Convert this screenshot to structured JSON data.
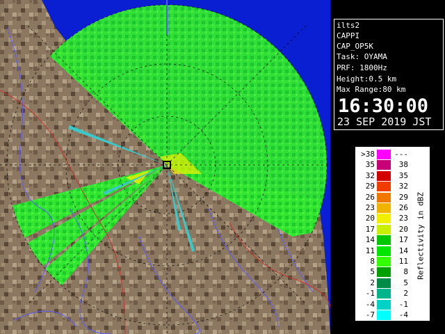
{
  "info": {
    "lines": [
      "ilts2",
      "CAPPI",
      "CAP_OP5K",
      "Task: OYAMA",
      "PRF: 1800Hz",
      "Height:0.5 km",
      "Max Range:80 km"
    ],
    "time": "16:30:00",
    "date": "23 SEP 2019 JST"
  },
  "legend": {
    "axis_label": "Reflectivity in dBZ",
    "rows": [
      {
        "lo": ">38",
        "hi": "---",
        "color": "#ff00ff"
      },
      {
        "lo": "35",
        "hi": "38",
        "color": "#c80078"
      },
      {
        "lo": "32",
        "hi": "35",
        "color": "#d20000"
      },
      {
        "lo": "29",
        "hi": "32",
        "color": "#f03c00"
      },
      {
        "lo": "26",
        "hi": "29",
        "color": "#f07800"
      },
      {
        "lo": "23",
        "hi": "26",
        "color": "#f0b400"
      },
      {
        "lo": "20",
        "hi": "23",
        "color": "#f0f000"
      },
      {
        "lo": "17",
        "hi": "20",
        "color": "#c8f000"
      },
      {
        "lo": "14",
        "hi": "17",
        "color": "#00c800"
      },
      {
        "lo": "11",
        "hi": "14",
        "color": "#00e600"
      },
      {
        "lo": "8",
        "hi": "11",
        "color": "#32ff00"
      },
      {
        "lo": "5",
        "hi": "8",
        "color": "#00a000"
      },
      {
        "lo": "2",
        "hi": "5",
        "color": "#008c46"
      },
      {
        "lo": "-1",
        "hi": "2",
        "color": "#00b48c"
      },
      {
        "lo": "-4",
        "hi": "-1",
        "color": "#00d2c8"
      },
      {
        "lo": "-7",
        "hi": "-4",
        "color": "#00ffff"
      }
    ]
  },
  "colors": {
    "sea": "#0a1ed2",
    "land": "#8c7860",
    "echo": "#28e628",
    "river": "#5a5aff",
    "border": "#c83232",
    "ring": "#000000",
    "blocked": "#3cc8c8"
  }
}
